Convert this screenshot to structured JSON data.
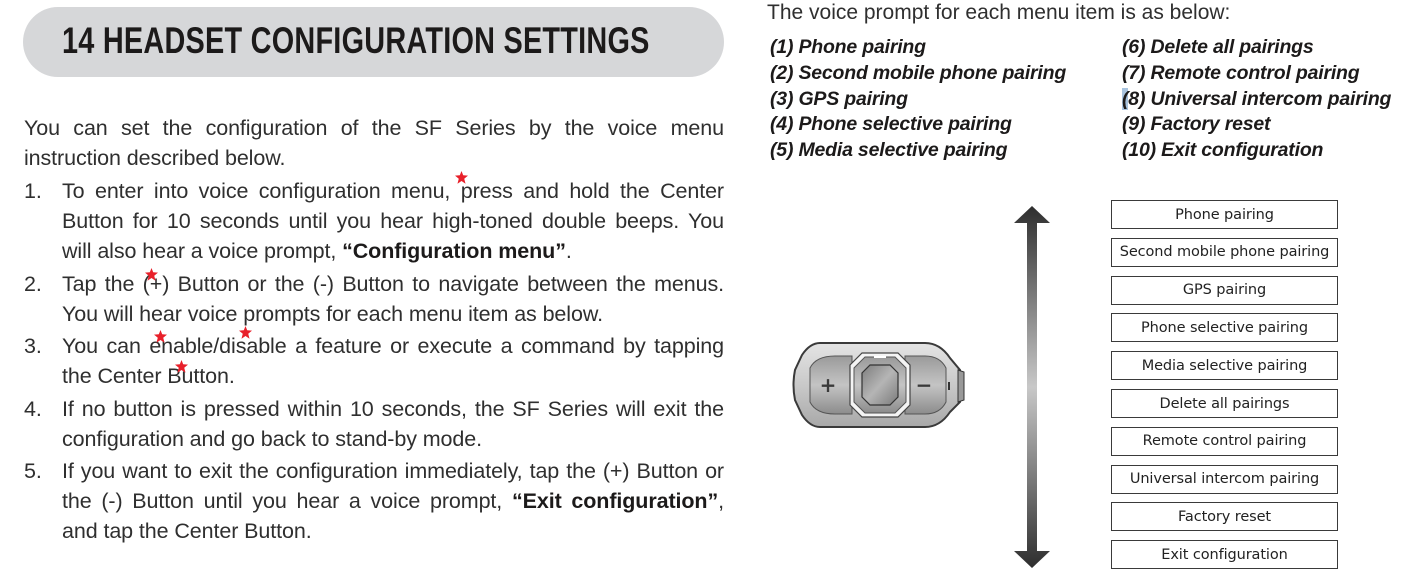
{
  "header": {
    "title": "14  HEADSET CONFIGURATION SETTINGS"
  },
  "intro": "You can set the configuration of the SF Series by the voice menu instruction described below.",
  "steps": [
    {
      "num": "1.",
      "parts": [
        {
          "text": "To enter into voice configuration menu, press and hold the Center Button for 10 seconds until you hear high-toned double beeps. You will also hear a voice prompt, "
        },
        {
          "text": "“Configuration menu”",
          "bold": true
        },
        {
          "text": "."
        }
      ]
    },
    {
      "num": "2.",
      "parts": [
        {
          "text": "Tap the (+) Button or the (-) Button to navigate between the menus. You will hear voice prompts for each menu item as below."
        }
      ]
    },
    {
      "num": "3.",
      "parts": [
        {
          "text": "You can enable/disable a feature or execute a command by tapping the Center Button."
        }
      ]
    },
    {
      "num": "4.",
      "parts": [
        {
          "text": "If no button is pressed within 10 seconds, the SF Series will exit the configuration and go back to stand-by mode."
        }
      ]
    },
    {
      "num": "5.",
      "parts": [
        {
          "text": "If you want to exit the configuration immediately, tap the (+) Button or the (-) Button until you hear a voice prompt, "
        },
        {
          "text": "“Exit configuration”",
          "bold": true
        },
        {
          "text": ", and tap the Center Button."
        }
      ]
    }
  ],
  "annotation_color": "#e8202a",
  "voice_prompts": {
    "intro": "The voice prompt for each menu item is as below:",
    "left": [
      "(1) Phone pairing",
      "(2) Second mobile phone pairing",
      "(3) GPS pairing",
      "(4) Phone selective pairing",
      "(5) Media selective pairing"
    ],
    "right": [
      "(6) Delete all pairings",
      "(7) Remote control pairing",
      "(8) Universal intercom pairing",
      "(9) Factory reset",
      "(10) Exit configuration"
    ],
    "selection_highlight_color": "#a9c4df"
  },
  "diagram": {
    "device": {
      "plus_label": "+",
      "minus_label": "−"
    },
    "menu_items": [
      "Phone pairing",
      "Second mobile phone pairing",
      "GPS pairing",
      "Phone selective pairing",
      "Media selective pairing",
      "Delete all pairings",
      "Remote control pairing",
      "Universal intercom pairing",
      "Factory reset",
      "Exit configuration"
    ]
  }
}
